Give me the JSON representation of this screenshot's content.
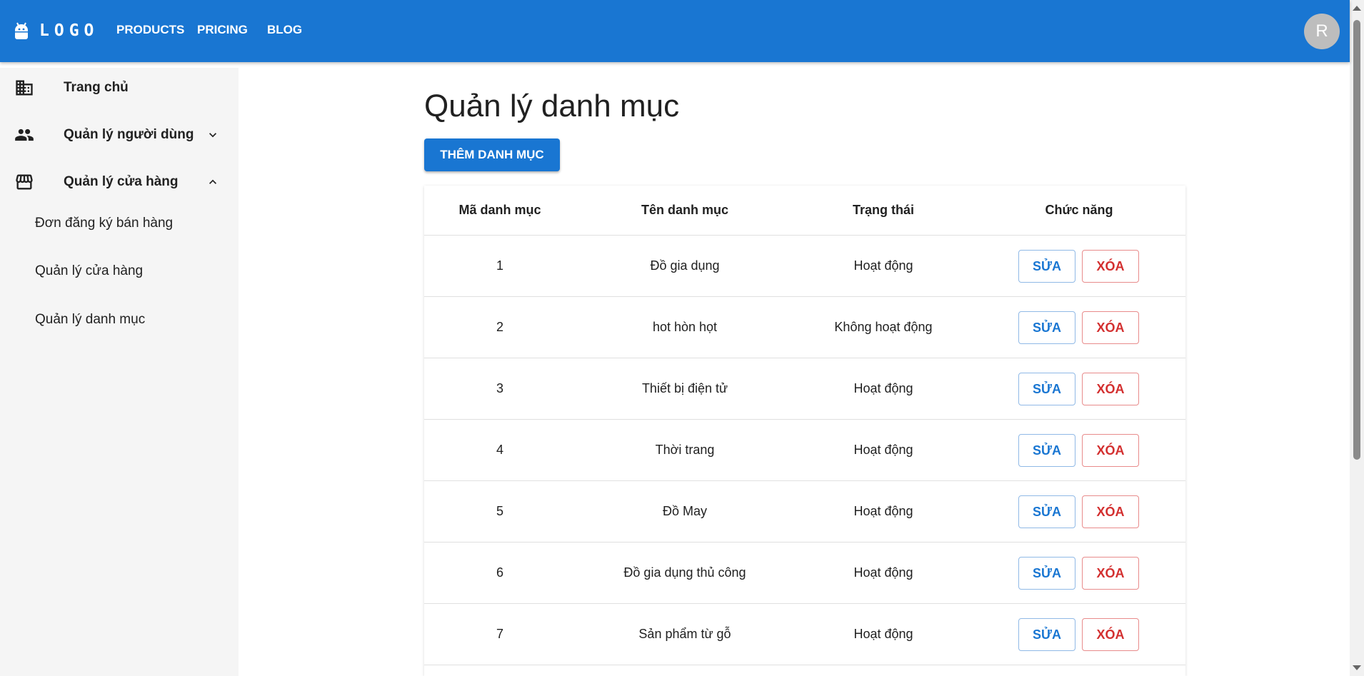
{
  "appbar": {
    "logo_text": "LOGO",
    "nav": [
      "PRODUCTS",
      "PRICING",
      "BLOG"
    ],
    "avatar_letter": "R",
    "color": "#1976d2"
  },
  "sidebar": {
    "items": [
      {
        "label": "Trang chủ",
        "icon": "building-icon"
      },
      {
        "label": "Quản lý người dùng",
        "icon": "people-icon",
        "chevron": "chevron-down-icon"
      },
      {
        "label": "Quản lý cửa hàng",
        "icon": "store-icon",
        "chevron": "chevron-up-icon"
      }
    ],
    "sub_items": [
      "Đơn đăng ký bán hàng",
      "Quản lý cửa hàng",
      "Quản lý danh mục"
    ]
  },
  "main": {
    "title": "Quản lý danh mục",
    "add_button": "THÊM DANH MỤC",
    "table": {
      "headers": [
        "Mã danh mục",
        "Tên danh mục",
        "Trạng thái",
        "Chức năng"
      ],
      "edit_label": "SỬA",
      "delete_label": "XÓA",
      "rows": [
        {
          "id": "1",
          "name": "Đồ gia dụng",
          "status": "Hoạt động"
        },
        {
          "id": "2",
          "name": "hot hòn họt",
          "status": "Không hoạt động"
        },
        {
          "id": "3",
          "name": "Thiết bị điện tử",
          "status": "Hoạt động"
        },
        {
          "id": "4",
          "name": "Thời trang",
          "status": "Hoạt động"
        },
        {
          "id": "5",
          "name": "Đồ May",
          "status": "Hoạt động"
        },
        {
          "id": "6",
          "name": "Đồ gia dụng thủ công",
          "status": "Hoạt động"
        },
        {
          "id": "7",
          "name": "Sản phẩm từ gỗ",
          "status": "Hoạt động"
        }
      ]
    }
  }
}
